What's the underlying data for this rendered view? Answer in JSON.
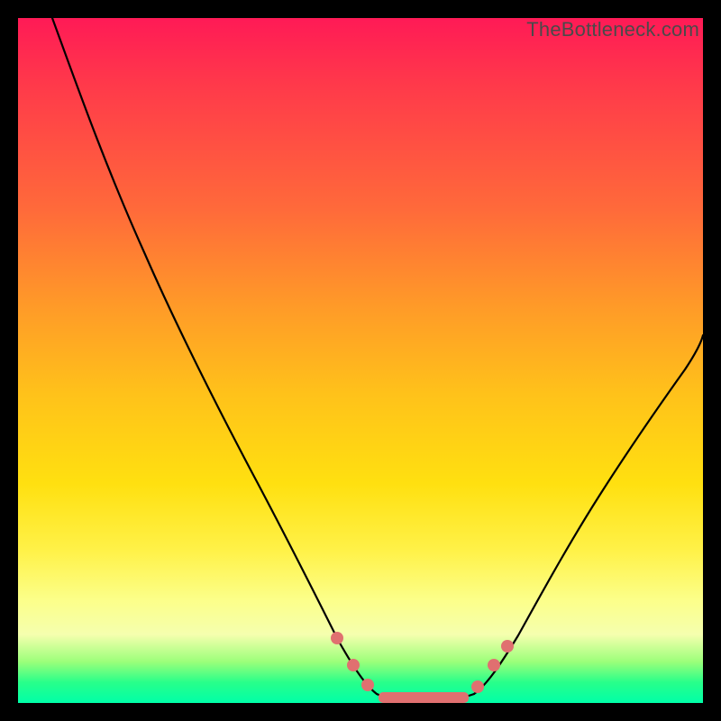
{
  "watermark": "TheBottleneck.com",
  "chart_data": {
    "type": "line",
    "title": "",
    "xlabel": "",
    "ylabel": "",
    "xlim": [
      0,
      100
    ],
    "ylim": [
      0,
      100
    ],
    "grid": false,
    "legend": false,
    "background_gradient": {
      "direction": "vertical",
      "stops": [
        {
          "pos": 0,
          "color": "#ff1a56"
        },
        {
          "pos": 28,
          "color": "#ff6a3a"
        },
        {
          "pos": 55,
          "color": "#ffc21a"
        },
        {
          "pos": 78,
          "color": "#fff24a"
        },
        {
          "pos": 90,
          "color": "#f5ffae"
        },
        {
          "pos": 100,
          "color": "#00ffa8"
        }
      ]
    },
    "series": [
      {
        "name": "left-branch",
        "description": "Steep descending curve from top-left entering the flat trough",
        "x": [
          5,
          10,
          15,
          20,
          25,
          30,
          35,
          40,
          43,
          46,
          49,
          52
        ],
        "y": [
          100,
          92,
          83,
          72,
          61,
          49,
          37,
          24,
          16,
          10,
          5,
          2
        ]
      },
      {
        "name": "trough",
        "description": "Flat bottom segment near y=0",
        "x": [
          52,
          55,
          58,
          61,
          64,
          67
        ],
        "y": [
          2,
          1,
          1,
          1,
          1,
          2
        ]
      },
      {
        "name": "right-branch",
        "description": "Rising curve from trough toward upper-right, flattening slightly near top",
        "x": [
          67,
          70,
          74,
          78,
          82,
          86,
          90,
          94,
          98,
          100
        ],
        "y": [
          2,
          6,
          13,
          21,
          29,
          37,
          44,
          50,
          54,
          56
        ]
      }
    ],
    "markers": {
      "color": "#e07070",
      "radius_approx_pct": 0.9,
      "points": [
        {
          "x": 46.5,
          "y": 9
        },
        {
          "x": 49.5,
          "y": 5
        },
        {
          "x": 51.5,
          "y": 3
        },
        {
          "x": 67.0,
          "y": 2.5
        },
        {
          "x": 69.5,
          "y": 5
        },
        {
          "x": 71.5,
          "y": 8
        }
      ],
      "trough_bar": {
        "x_start": 53,
        "x_end": 65,
        "y": 1
      }
    }
  }
}
